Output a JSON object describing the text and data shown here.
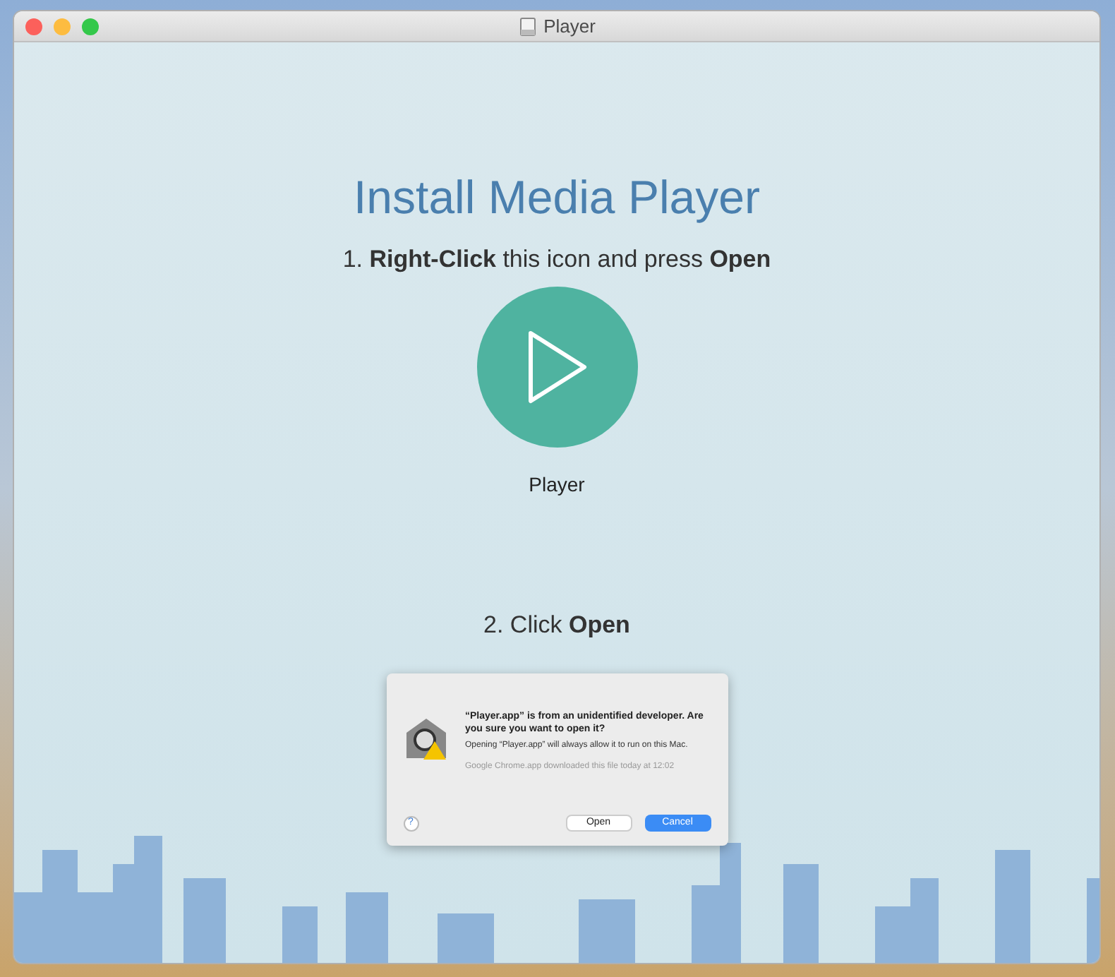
{
  "window": {
    "title": "Player"
  },
  "heading": "Install Media Player",
  "step_1": "1. **Right-Click** this icon and press **Open**",
  "app_icon": {
    "label": "Player"
  },
  "step_2": "2. Click **Open**",
  "dialog": {
    "title": "“Player.app” is from an unidentified developer. Are you sure you want to open it?",
    "message": "Opening “Player.app” will always allow it to run on this Mac.",
    "note": "Google Chrome.app downloaded this file today at 12:02",
    "help": "?",
    "buttons": [
      {
        "label": "Open",
        "default": false
      },
      {
        "label": "Cancel",
        "default": true
      }
    ]
  }
}
